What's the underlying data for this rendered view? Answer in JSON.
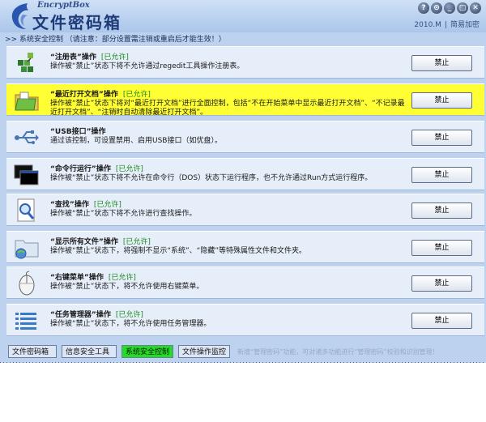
{
  "header": {
    "brand_en": "EncryptBox",
    "brand_cn": "文件密码箱",
    "window_buttons": [
      "?",
      "⊙",
      "_",
      "▢",
      "✕"
    ],
    "version": "2010.M",
    "separator": "|",
    "link": "简易加密"
  },
  "notice": ">> 系统安全控制 （请注意：部分设置需注销或重启后才能生效！）",
  "rows": [
    {
      "icon": "registry-icon",
      "title": "“注册表”操作",
      "status": "[已允许]",
      "desc": "操作被“禁止”状态下将不允许通过regedit工具操作注册表。",
      "button": "禁止"
    },
    {
      "icon": "folder-docs-icon",
      "title": "“最近打开文档”操作",
      "status": "[已允许]",
      "desc": "操作被“禁止”状态下将对“最近打开文档”进行全面控制，包括“不在开始菜单中显示最近打开文档”、“不记录最近打开文档”、“注销时自动清除最近打开文档”。",
      "button": "禁止"
    },
    {
      "icon": "usb-icon",
      "title": "“USB接口”操作",
      "status": "",
      "desc": "通过该控制，可设置禁用、启用USB接口（如优盘）。",
      "button": "禁止"
    },
    {
      "icon": "command-line-icon",
      "title": "“命令行运行”操作",
      "status": "[已允许]",
      "desc": "操作被“禁止”状态下将不允许在命令行（DOS）状态下运行程序，也不允许通过Run方式运行程序。",
      "button": "禁止"
    },
    {
      "icon": "search-icon",
      "title": "“查找”操作",
      "status": "[已允许]",
      "desc": "操作被“禁止”状态下将不允许进行查找操作。",
      "button": "禁止"
    },
    {
      "icon": "hidden-files-icon",
      "title": "“显示所有文件”操作",
      "status": "[已允许]",
      "desc": "操作被“禁止”状态下，将强制不显示“系统”、“隐藏”等特殊属性文件和文件夹。",
      "button": "禁止"
    },
    {
      "icon": "mouse-icon",
      "title": "“右键菜单”操作",
      "status": "[已允许]",
      "desc": "操作被“禁止”状态下，将不允许使用右键菜单。",
      "button": "禁止"
    },
    {
      "icon": "task-manager-icon",
      "title": "“任务管理器”操作",
      "status": "[已允许]",
      "desc": "操作被“禁止”状态下，将不允许使用任务管理器。",
      "button": "禁止"
    }
  ],
  "footer": {
    "tabs": [
      "文件密码箱",
      "信息安全工具",
      "系统安全控制",
      "文件操作监控"
    ],
    "active_tab": "系统安全控制",
    "info": "新增“管理密码”功能，可对诸多功能进行“管理密码”校验和识别管理！"
  },
  "colors": {
    "accent_active": "#22dd22",
    "highlight_row": "#ffff33",
    "status_allowed": "#1b8a1b"
  }
}
